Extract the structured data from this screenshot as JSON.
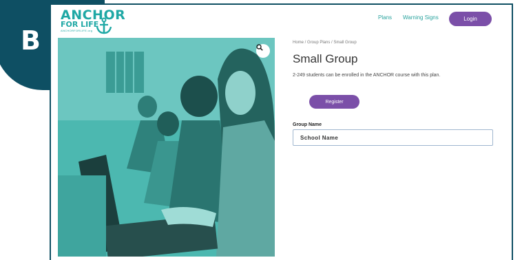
{
  "badge": {
    "letter": "B"
  },
  "logo": {
    "line1": "ANCHOR",
    "line2": "FOR LIFE",
    "tagline": "ANCHORFORLIFE.org"
  },
  "nav": {
    "plans": "Plans",
    "warning_signs": "Warning Signs",
    "login": "Login"
  },
  "breadcrumb": "Home / Group Plans / Small Group",
  "title": "Small Group",
  "description": "2-249 students can be enrolled in the ANCHOR course with this plan.",
  "register_label": "Register",
  "group_name": {
    "label": "Group Name",
    "value": "School Name"
  },
  "icons": {
    "zoom": "magnifier-icon",
    "logo_mark": "anchor-icon"
  },
  "colors": {
    "accent_purple": "#7b4fa8",
    "brand_teal": "#1fa8a5",
    "badge_navy": "#0e4f63"
  }
}
